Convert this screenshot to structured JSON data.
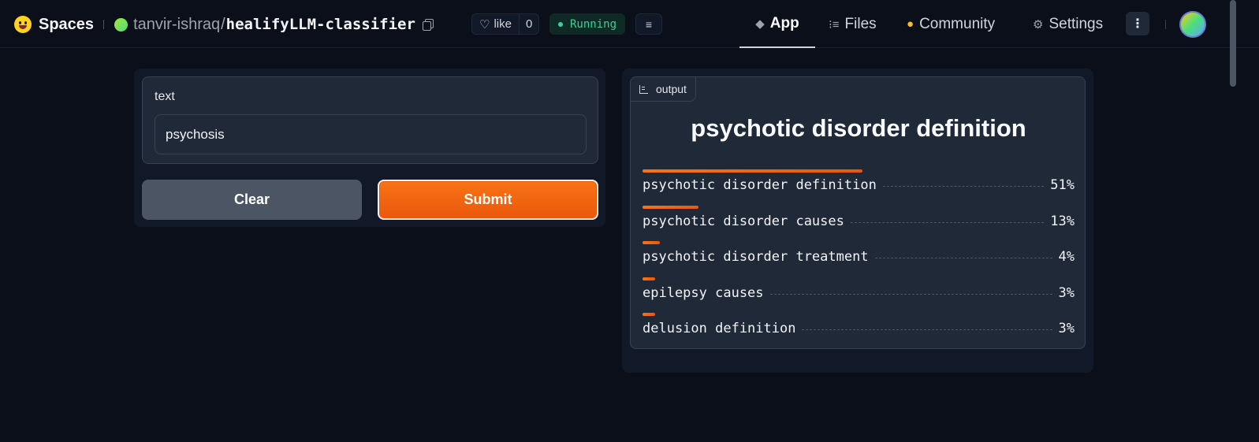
{
  "header": {
    "spaces_label": "Spaces",
    "owner": "tanvir-ishraq",
    "slash": "/",
    "repo": "healifyLLM-classifier",
    "like_label": "like",
    "like_count": "0",
    "status": "Running",
    "nav": {
      "app": "App",
      "files": "Files",
      "community": "Community",
      "settings": "Settings"
    },
    "icons": {
      "logo": "hugging-face-logo-icon",
      "copy": "copy-icon",
      "like": "heart-icon",
      "logs": "logs-icon",
      "app": "cube-icon",
      "files": "files-icon",
      "community": "community-icon",
      "settings": "gear-icon",
      "more": "more-vertical-icon"
    }
  },
  "input": {
    "label": "text",
    "value": "psychosis",
    "clear_label": "Clear",
    "submit_label": "Submit"
  },
  "output": {
    "tag_label": "output",
    "title": "psychotic disorder definition",
    "confidences": [
      {
        "label": "psychotic disorder definition",
        "pct": "51%",
        "value": 0.51
      },
      {
        "label": "psychotic disorder causes",
        "pct": "13%",
        "value": 0.13
      },
      {
        "label": "psychotic disorder treatment",
        "pct": "4%",
        "value": 0.04
      },
      {
        "label": "epilepsy causes",
        "pct": "3%",
        "value": 0.03
      },
      {
        "label": "delusion definition",
        "pct": "3%",
        "value": 0.03
      }
    ]
  },
  "colors": {
    "accent": "#f97316",
    "background": "#0b0f19",
    "panel": "#111827",
    "running": "#34d399"
  }
}
